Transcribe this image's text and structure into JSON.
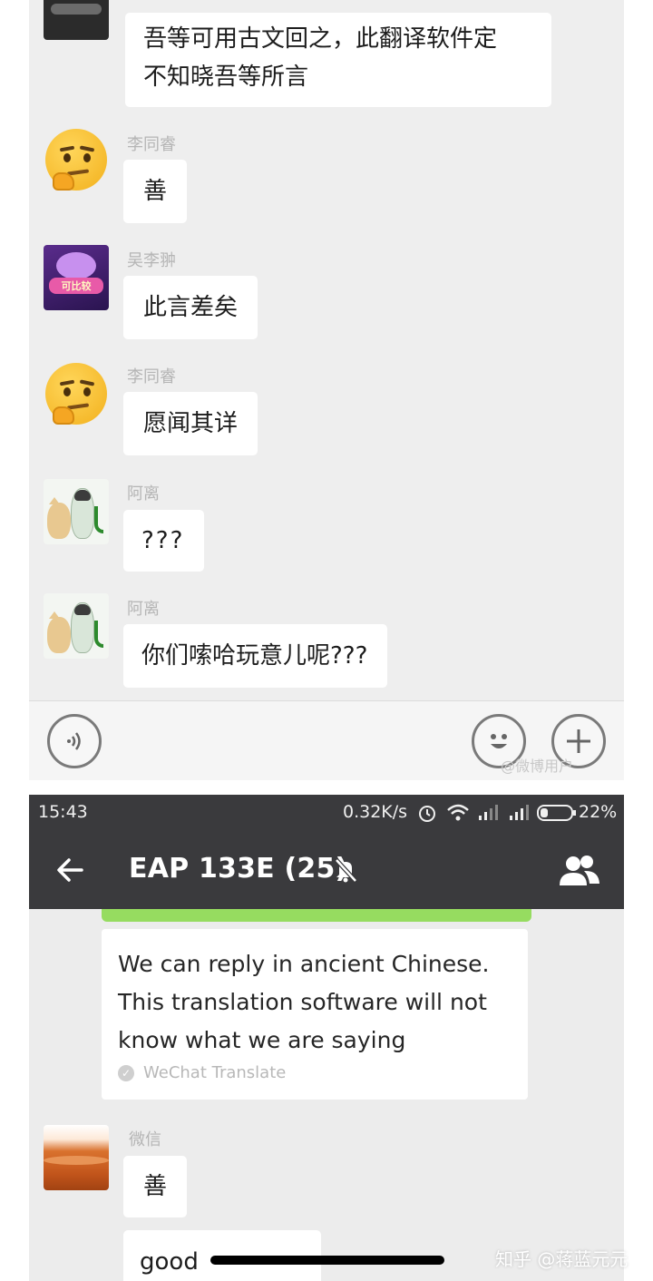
{
  "top_chat": {
    "first_message": [
      "吾等可用古文回之，此翻译软件定",
      "不知晓吾等所言"
    ],
    "messages": [
      {
        "sender": "李同睿",
        "text": "善"
      },
      {
        "sender": "吴李翀",
        "text": "此言差矣"
      },
      {
        "sender": "李同睿",
        "text": "愿闻其详"
      },
      {
        "sender": "阿离",
        "text": "???"
      },
      {
        "sender": "阿离",
        "text": "你们嗦哈玩意儿呢???"
      }
    ],
    "avatar_badge_text": "可比较",
    "toolbar": {
      "voice_icon": "voice-wave-icon",
      "emoji_icon": "smile-icon",
      "plus_icon": "plus-icon",
      "watermark": "@微博用户"
    }
  },
  "bottom_chat": {
    "status_bar": {
      "time": "15:43",
      "speed": "0.32K/s",
      "battery": "22%",
      "icons": [
        "alarm-icon",
        "wifi-icon",
        "signal-icon",
        "signal-icon",
        "battery-icon"
      ]
    },
    "nav": {
      "back_icon": "back-arrow-icon",
      "title": "EAP 133E (25)",
      "mute_icon": "bell-muted-icon",
      "members_icon": "group-members-icon"
    },
    "translated_message": {
      "lines": [
        "We can reply in ancient Chinese.",
        "This translation software will not",
        "know what we are saying"
      ],
      "source": "WeChat Translate"
    },
    "messages": [
      {
        "sender": "微信",
        "text": "善"
      },
      {
        "text": "good"
      }
    ]
  },
  "zhihu_watermark": "知乎 @蒋蓝元元",
  "colors": {
    "chat_bg": "#eeeeee",
    "bubble": "#ffffff",
    "topbar": "#3a3a3d",
    "accent_green": "#96dc60"
  }
}
